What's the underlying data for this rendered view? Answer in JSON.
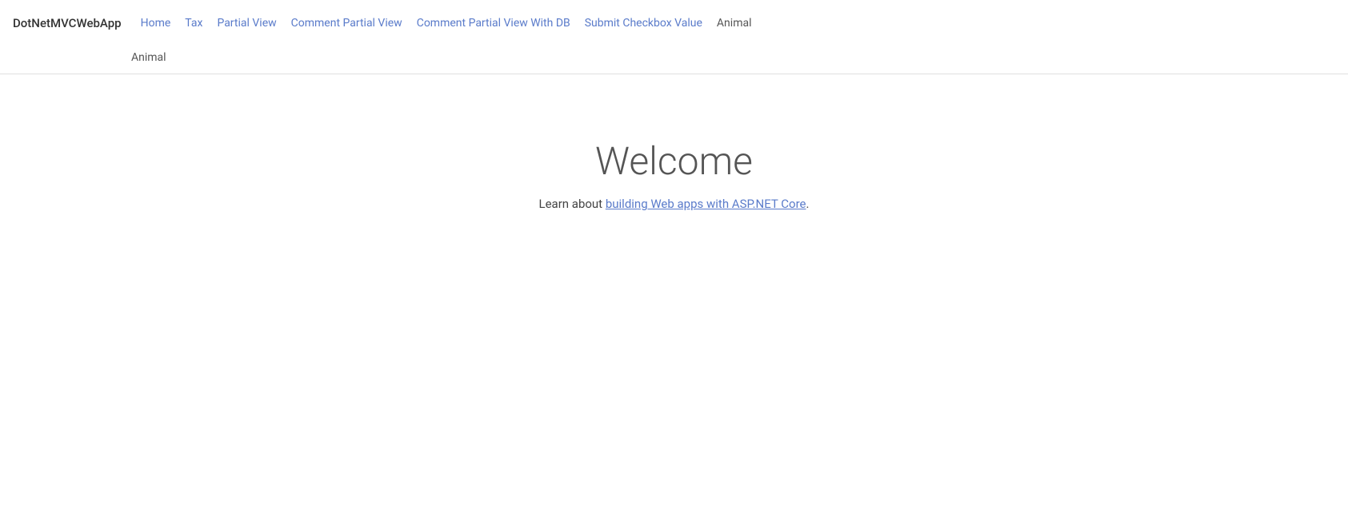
{
  "brand": {
    "label": "DotNetMVCWebApp"
  },
  "nav": {
    "row1": [
      {
        "label": "Home",
        "style": "normal"
      },
      {
        "label": "Tax",
        "style": "normal"
      },
      {
        "label": "Partial View",
        "style": "normal"
      },
      {
        "label": "Comment Partial View",
        "style": "normal"
      },
      {
        "label": "Comment Partial View With DB",
        "style": "normal"
      },
      {
        "label": "Submit Checkbox Value",
        "style": "normal"
      },
      {
        "label": "Animal",
        "style": "dark"
      }
    ],
    "row2": [
      {
        "label": "Animal",
        "style": "dark"
      }
    ]
  },
  "main": {
    "welcome_title": "Welcome",
    "learn_prefix": "Learn about ",
    "learn_link_text": "building Web apps with ASP.NET Core",
    "learn_suffix": "."
  }
}
